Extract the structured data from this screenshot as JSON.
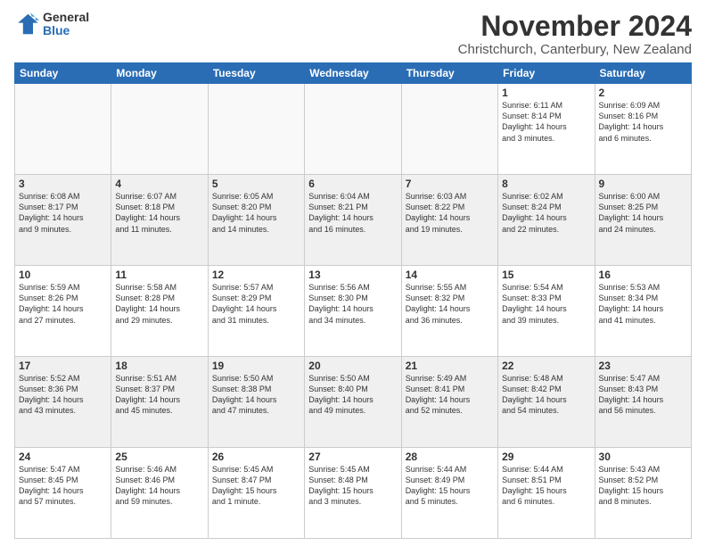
{
  "logo": {
    "general": "General",
    "blue": "Blue"
  },
  "title": "November 2024",
  "subtitle": "Christchurch, Canterbury, New Zealand",
  "headers": [
    "Sunday",
    "Monday",
    "Tuesday",
    "Wednesday",
    "Thursday",
    "Friday",
    "Saturday"
  ],
  "rows": [
    [
      {
        "day": "",
        "info": "",
        "empty": true
      },
      {
        "day": "",
        "info": "",
        "empty": true
      },
      {
        "day": "",
        "info": "",
        "empty": true
      },
      {
        "day": "",
        "info": "",
        "empty": true
      },
      {
        "day": "",
        "info": "",
        "empty": true
      },
      {
        "day": "1",
        "info": "Sunrise: 6:11 AM\nSunset: 8:14 PM\nDaylight: 14 hours\nand 3 minutes."
      },
      {
        "day": "2",
        "info": "Sunrise: 6:09 AM\nSunset: 8:16 PM\nDaylight: 14 hours\nand 6 minutes."
      }
    ],
    [
      {
        "day": "3",
        "info": "Sunrise: 6:08 AM\nSunset: 8:17 PM\nDaylight: 14 hours\nand 9 minutes."
      },
      {
        "day": "4",
        "info": "Sunrise: 6:07 AM\nSunset: 8:18 PM\nDaylight: 14 hours\nand 11 minutes."
      },
      {
        "day": "5",
        "info": "Sunrise: 6:05 AM\nSunset: 8:20 PM\nDaylight: 14 hours\nand 14 minutes."
      },
      {
        "day": "6",
        "info": "Sunrise: 6:04 AM\nSunset: 8:21 PM\nDaylight: 14 hours\nand 16 minutes."
      },
      {
        "day": "7",
        "info": "Sunrise: 6:03 AM\nSunset: 8:22 PM\nDaylight: 14 hours\nand 19 minutes."
      },
      {
        "day": "8",
        "info": "Sunrise: 6:02 AM\nSunset: 8:24 PM\nDaylight: 14 hours\nand 22 minutes."
      },
      {
        "day": "9",
        "info": "Sunrise: 6:00 AM\nSunset: 8:25 PM\nDaylight: 14 hours\nand 24 minutes."
      }
    ],
    [
      {
        "day": "10",
        "info": "Sunrise: 5:59 AM\nSunset: 8:26 PM\nDaylight: 14 hours\nand 27 minutes."
      },
      {
        "day": "11",
        "info": "Sunrise: 5:58 AM\nSunset: 8:28 PM\nDaylight: 14 hours\nand 29 minutes."
      },
      {
        "day": "12",
        "info": "Sunrise: 5:57 AM\nSunset: 8:29 PM\nDaylight: 14 hours\nand 31 minutes."
      },
      {
        "day": "13",
        "info": "Sunrise: 5:56 AM\nSunset: 8:30 PM\nDaylight: 14 hours\nand 34 minutes."
      },
      {
        "day": "14",
        "info": "Sunrise: 5:55 AM\nSunset: 8:32 PM\nDaylight: 14 hours\nand 36 minutes."
      },
      {
        "day": "15",
        "info": "Sunrise: 5:54 AM\nSunset: 8:33 PM\nDaylight: 14 hours\nand 39 minutes."
      },
      {
        "day": "16",
        "info": "Sunrise: 5:53 AM\nSunset: 8:34 PM\nDaylight: 14 hours\nand 41 minutes."
      }
    ],
    [
      {
        "day": "17",
        "info": "Sunrise: 5:52 AM\nSunset: 8:36 PM\nDaylight: 14 hours\nand 43 minutes."
      },
      {
        "day": "18",
        "info": "Sunrise: 5:51 AM\nSunset: 8:37 PM\nDaylight: 14 hours\nand 45 minutes."
      },
      {
        "day": "19",
        "info": "Sunrise: 5:50 AM\nSunset: 8:38 PM\nDaylight: 14 hours\nand 47 minutes."
      },
      {
        "day": "20",
        "info": "Sunrise: 5:50 AM\nSunset: 8:40 PM\nDaylight: 14 hours\nand 49 minutes."
      },
      {
        "day": "21",
        "info": "Sunrise: 5:49 AM\nSunset: 8:41 PM\nDaylight: 14 hours\nand 52 minutes."
      },
      {
        "day": "22",
        "info": "Sunrise: 5:48 AM\nSunset: 8:42 PM\nDaylight: 14 hours\nand 54 minutes."
      },
      {
        "day": "23",
        "info": "Sunrise: 5:47 AM\nSunset: 8:43 PM\nDaylight: 14 hours\nand 56 minutes."
      }
    ],
    [
      {
        "day": "24",
        "info": "Sunrise: 5:47 AM\nSunset: 8:45 PM\nDaylight: 14 hours\nand 57 minutes."
      },
      {
        "day": "25",
        "info": "Sunrise: 5:46 AM\nSunset: 8:46 PM\nDaylight: 14 hours\nand 59 minutes."
      },
      {
        "day": "26",
        "info": "Sunrise: 5:45 AM\nSunset: 8:47 PM\nDaylight: 15 hours\nand 1 minute."
      },
      {
        "day": "27",
        "info": "Sunrise: 5:45 AM\nSunset: 8:48 PM\nDaylight: 15 hours\nand 3 minutes."
      },
      {
        "day": "28",
        "info": "Sunrise: 5:44 AM\nSunset: 8:49 PM\nDaylight: 15 hours\nand 5 minutes."
      },
      {
        "day": "29",
        "info": "Sunrise: 5:44 AM\nSunset: 8:51 PM\nDaylight: 15 hours\nand 6 minutes."
      },
      {
        "day": "30",
        "info": "Sunrise: 5:43 AM\nSunset: 8:52 PM\nDaylight: 15 hours\nand 8 minutes."
      }
    ]
  ],
  "shaded_rows": [
    1,
    3
  ]
}
